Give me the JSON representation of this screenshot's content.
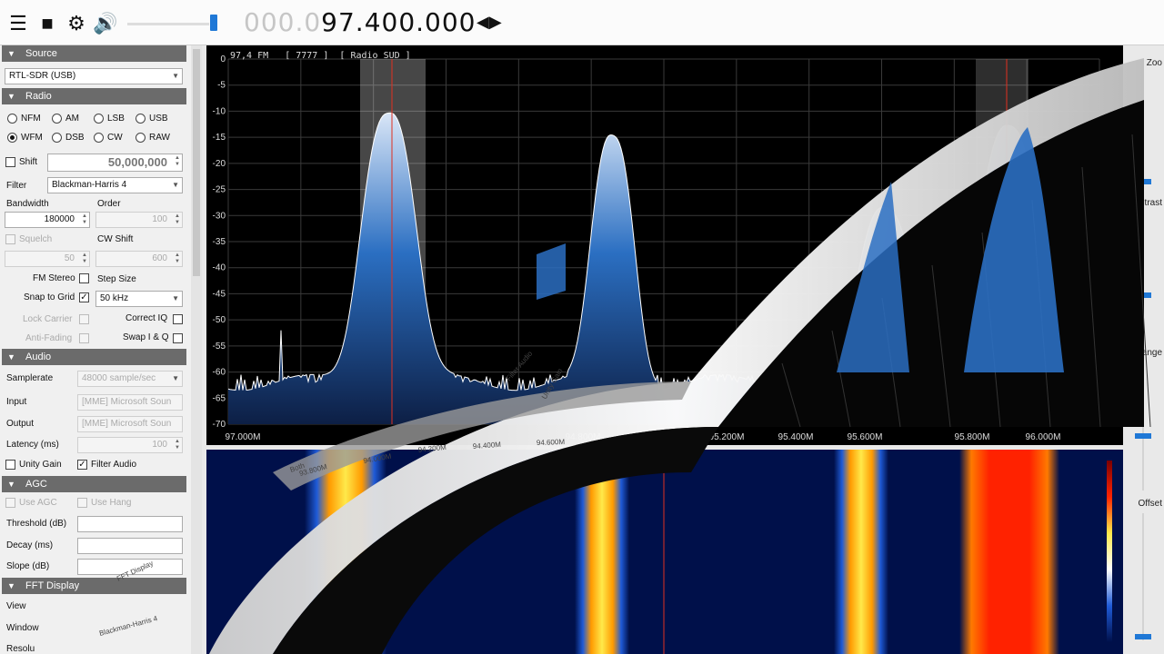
{
  "toolbar": {
    "menu_icon": "hamburger-icon",
    "stop_icon": "stop-icon",
    "settings_icon": "gear-icon",
    "audio_icon": "speaker-icon",
    "frequency_dim": "000.0",
    "frequency_active": "97.400.000",
    "tune_arrows_icon": "left-right-arrows-icon"
  },
  "source": {
    "header": "Source",
    "device": "RTL-SDR (USB)"
  },
  "radio": {
    "header": "Radio",
    "modes": [
      "NFM",
      "AM",
      "LSB",
      "USB",
      "WFM",
      "DSB",
      "CW",
      "RAW"
    ],
    "selected_mode": "WFM",
    "shift_label": "Shift",
    "shift_value": "50,000,000",
    "filter_label": "Filter",
    "filter_value": "Blackman-Harris 4",
    "bandwidth_label": "Bandwidth",
    "bandwidth_value": "180000",
    "order_label": "Order",
    "order_value": "100",
    "squelch_label": "Squelch",
    "squelch_value": "50",
    "cw_shift_label": "CW Shift",
    "cw_shift_value": "600",
    "fm_stereo_label": "FM Stereo",
    "step_size_label": "Step Size",
    "snap_label": "Snap to Grid",
    "snap_value": "50 kHz",
    "lock_carrier_label": "Lock Carrier",
    "correct_iq_label": "Correct IQ",
    "anti_fading_label": "Anti-Fading",
    "swap_iq_label": "Swap I & Q"
  },
  "audio": {
    "header": "Audio",
    "samplerate_label": "Samplerate",
    "samplerate_value": "48000 sample/sec",
    "input_label": "Input",
    "input_value": "[MME] Microsoft Soun",
    "output_label": "Output",
    "output_value": "[MME] Microsoft Soun",
    "latency_label": "Latency (ms)",
    "latency_value": "100",
    "unity_gain_label": "Unity Gain",
    "filter_audio_label": "Filter Audio"
  },
  "agc": {
    "header": "AGC",
    "use_agc_label": "Use AGC",
    "use_hang_label": "Use Hang",
    "threshold_label": "Threshold (dB)",
    "decay_label": "Decay (ms)",
    "slope_label": "Slope (dB)"
  },
  "fft": {
    "header": "FFT Display",
    "view_label": "View",
    "window_label": "Window",
    "resolution_label": "Resolu"
  },
  "spectrum": {
    "header": "97,4 FM   [ 7777 ]  [ Radio SUD ]",
    "y_ticks": [
      "0",
      "-5",
      "-10",
      "-15",
      "-20",
      "-25",
      "-30",
      "-35",
      "-40",
      "-45",
      "-50",
      "-55",
      "-60",
      "-65",
      "-70"
    ],
    "x_ticks": [
      "97.000M",
      "94.800M",
      "95.000M",
      "95.200M",
      "95.400M",
      "95.600M",
      "95.800M",
      "96.000M"
    ],
    "line_color": "#ffffff",
    "fill_color": "#2b6fc2",
    "marker_color": "#e03020"
  },
  "right_panel": {
    "zoom_label": "Zoo",
    "contrast_label": "Contrast",
    "range_label": "Range",
    "offset_label": "Offset"
  },
  "overlay_panel": {
    "texts": [
      "Filter Audio",
      "Unity Gain",
      "FFT Display",
      "Blackman-Harris 4",
      "Both",
      "94.000M",
      "94.200M",
      "94.400M",
      "94.600M",
      "93.800M"
    ]
  }
}
